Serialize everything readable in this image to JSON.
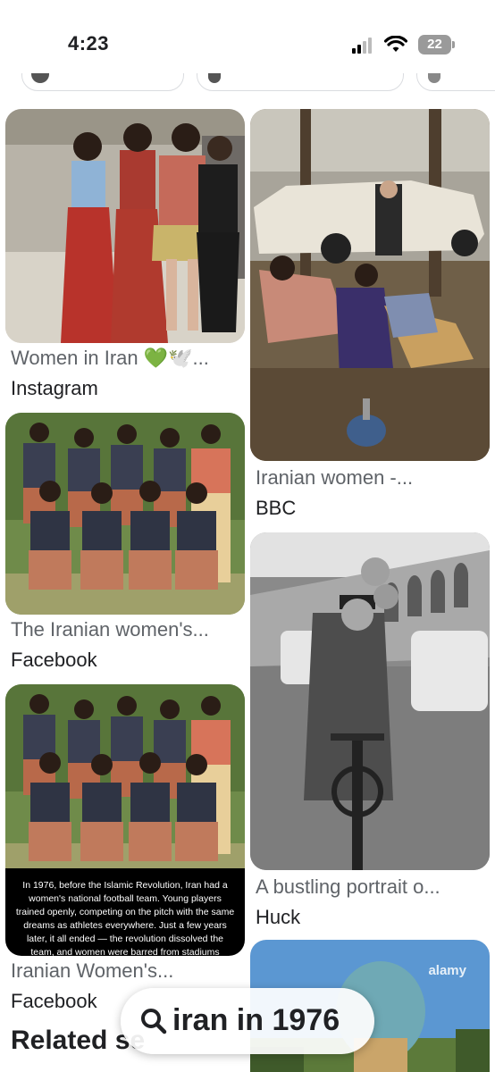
{
  "status_bar": {
    "time": "4:23",
    "battery": "22"
  },
  "results": {
    "left": [
      {
        "title": "Women in Iran 💚🕊️...",
        "source": "Instagram"
      },
      {
        "title": "The Iranian women's...",
        "source": "Facebook"
      },
      {
        "title": "Iranian Women's...",
        "source": "Facebook",
        "caption": "In 1976, before the Islamic Revolution, Iran had a women's national football team. Young players trained openly, competing on the pitch with the same dreams as athletes everywhere. Just a few years later, it all ended — the revolution dissolved the team, and women were barred from stadiums"
      }
    ],
    "right": [
      {
        "title": "Iranian women -...",
        "source": "BBC"
      },
      {
        "title": "A bustling portrait o...",
        "source": "Huck"
      },
      {
        "watermark": "alamy"
      }
    ]
  },
  "related_heading": "Related se",
  "search": {
    "query": "iran in 1976"
  }
}
